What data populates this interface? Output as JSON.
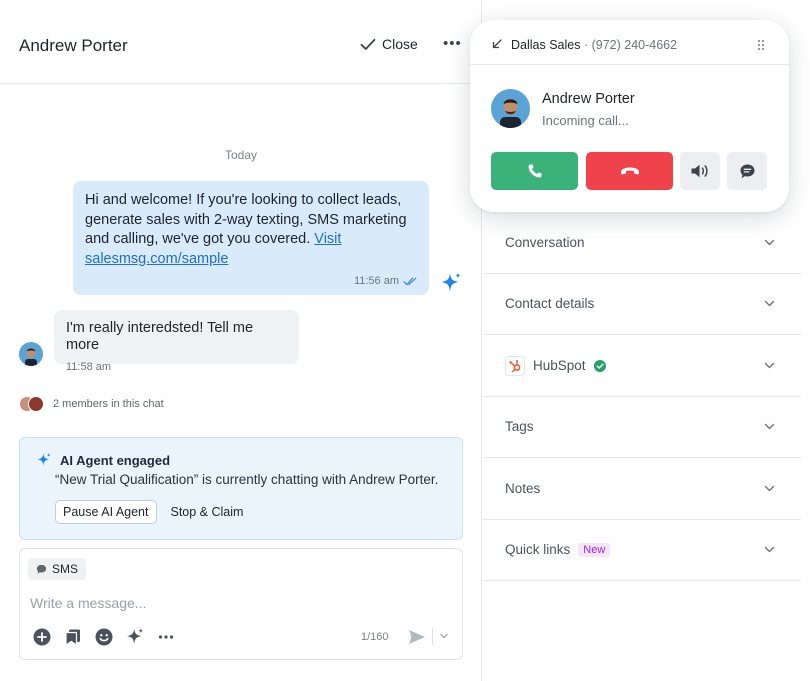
{
  "chat": {
    "contact_name": "Andrew Porter",
    "close_label": "Close",
    "more_glyph": "•••",
    "day_label": "Today",
    "outgoing": {
      "text": "Hi and welcome! If you're looking to collect leads, generate sales with 2-way texting, SMS marketing and calling, we've got you covered.",
      "link_text": "Visit salesmsg.com/sample",
      "time": "11:56 am"
    },
    "incoming": {
      "text": "I'm really interedsted! Tell me more",
      "time": "11:58 am"
    },
    "members_text": "2 members in this chat",
    "ai_card": {
      "title": "AI Agent engaged",
      "description": "“New Trial Qualification” is currently chatting with Andrew Porter.",
      "pause_label": "Pause AI Agent",
      "stop_label": "Stop & Claim"
    },
    "composer": {
      "channel_label": "SMS",
      "placeholder": "Write a message...",
      "char_count": "1/160"
    }
  },
  "sidebar": {
    "sections": [
      {
        "label": "Conversation"
      },
      {
        "label": "Contact details"
      },
      {
        "label": "HubSpot"
      },
      {
        "label": "Tags"
      },
      {
        "label": "Notes"
      },
      {
        "label": "Quick links",
        "badge": "New"
      }
    ]
  },
  "call_popup": {
    "line_name": "Dallas Sales",
    "line_number": "(972) 240-4662",
    "caller_name": "Andrew Porter",
    "status": "Incoming call..."
  },
  "colors": {
    "accept": "#3bb27a",
    "decline": "#f0424a",
    "outgoing_bubble": "#d9ebfb",
    "ai_card": "#eaf4fd",
    "link": "#1d6fd0",
    "new_badge": "#9d2ad6"
  }
}
